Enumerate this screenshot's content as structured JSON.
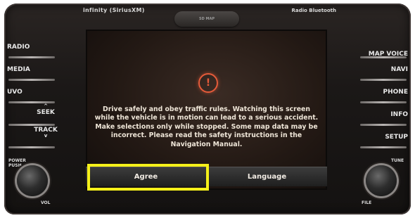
{
  "header": {
    "brand": "infinity (SiriusXM)",
    "center_tab": "SD MAP",
    "right_label": "Radio  Bluetooth"
  },
  "left_buttons": [
    "RADIO",
    "MEDIA",
    "UVO",
    "SEEK",
    "TRACK"
  ],
  "right_buttons": [
    "MAP VOICE",
    "NAVI",
    "PHONE",
    "INFO",
    "SETUP"
  ],
  "knobs": {
    "left_top": "POWER PUSH",
    "left_bottom": "VOL",
    "right_top": "TUNE",
    "right_bottom": "FILE"
  },
  "screen": {
    "message": "Drive safely and obey traffic rules. Watching this screen while the vehicle is in motion can lead to a serious accident. Make selections only while stopped. Some map data may be incorrect. Please read the safety instructions in the Navigation Manual.",
    "buttons": {
      "agree": "Agree",
      "language": "Language"
    }
  },
  "colors": {
    "alert": "#e55b3a",
    "highlight": "#f5f01a"
  },
  "icons": {
    "alert": "warning-icon"
  }
}
